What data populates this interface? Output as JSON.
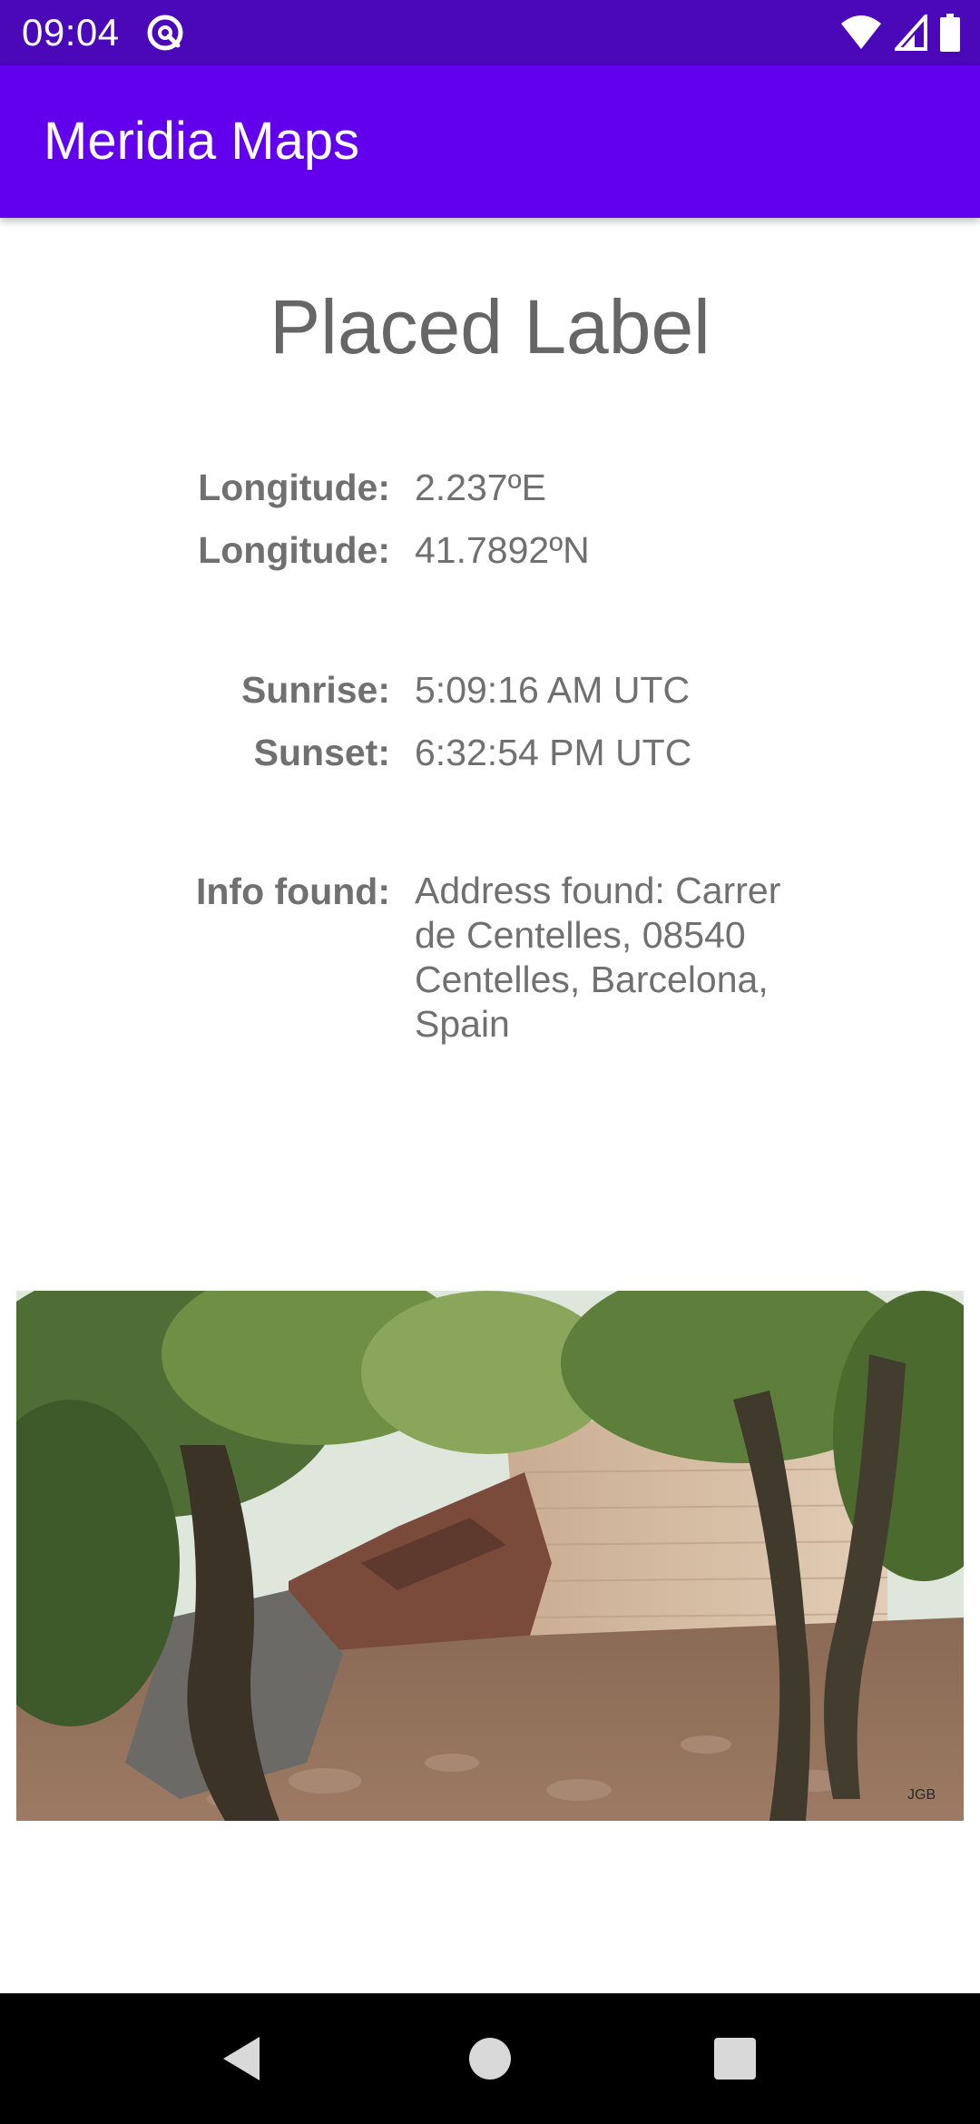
{
  "status_bar": {
    "time": "09:04",
    "app_icon": "at-sign-icon",
    "icons": [
      "wifi-icon",
      "signal-icon",
      "battery-icon"
    ],
    "background": "#4a08b8"
  },
  "app_bar": {
    "title": "Meridia Maps",
    "background": "#6200ee"
  },
  "content": {
    "title": "Placed Label",
    "coordinates": [
      {
        "label": "Longitude:",
        "value": "2.237ºE"
      },
      {
        "label": "Longitude:",
        "value": "41.7892ºN"
      }
    ],
    "sun": [
      {
        "label": "Sunrise:",
        "value": "5:09:16 AM UTC"
      },
      {
        "label": "Sunset:",
        "value": "6:32:54 PM UTC"
      }
    ],
    "info": {
      "label": "Info found:",
      "value": "Address found: Carrer de Centelles, 08540 Centelles, Barcelona, Spain"
    },
    "photo": {
      "description_icon": "location-photo",
      "watermark": "JGB"
    }
  },
  "nav_bar": {
    "icons": [
      "back-icon",
      "home-icon",
      "recents-icon"
    ]
  }
}
